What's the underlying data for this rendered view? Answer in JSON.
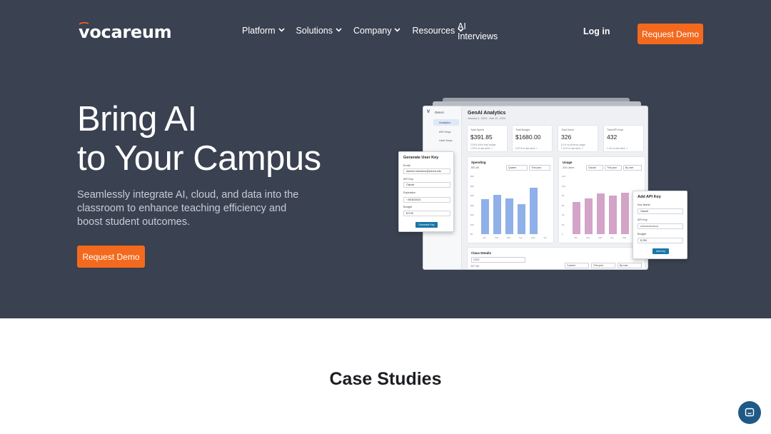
{
  "brand": {
    "logo_text": "vocareum",
    "accent_color": "#f36a1e",
    "hero_bg": "#3a4150"
  },
  "nav": {
    "items": [
      {
        "label": "Platform"
      },
      {
        "label": "Solutions"
      },
      {
        "label": "Company"
      },
      {
        "label": "Resources"
      }
    ],
    "ai_interviews": {
      "line1": "AI",
      "line2": "Interviews"
    },
    "login": "Log in",
    "request_demo": "Request Demo"
  },
  "hero": {
    "headline_line1": "Bring AI",
    "headline_line2": "to Your Campus",
    "subtext": "Seamlessly integrate AI, cloud, and data into the classroom to enhance teaching efficiency and boost student outcomes.",
    "cta": "Request Demo"
  },
  "mockup": {
    "sidebar": {
      "logo": "V",
      "title": "GenAI",
      "items": [
        "Analytics",
        "API Keys",
        "User Keys"
      ]
    },
    "title": "GenAI Analytics",
    "date_range": "January 1, 2024 - Mar 20, 2024",
    "stats": [
      {
        "label": "Total Spend",
        "value": "$391.85",
        "sub1": "23.8% of the total budget",
        "sub2": "1.29% vs last week ↗"
      },
      {
        "label": "Total Budget",
        "value": "$1680.00",
        "sub1": "",
        "sub2": "0.87% vs last week ↗"
      },
      {
        "label": "Total Users",
        "value": "326",
        "sub1": "8.1% vs previous usage",
        "sub2": "1.12% vs last week ↗"
      },
      {
        "label": "Total API Keys",
        "value": "432",
        "sub1": "",
        "sub2": "1.1% vs last week ↗"
      }
    ],
    "spending": {
      "title": "Spending",
      "total": "$91.85",
      "filters": [
        "Quarter",
        "This year"
      ],
      "yticks": [
        "$60",
        "$50",
        "$40",
        "$30",
        "$20",
        "$10",
        "$0"
      ],
      "months": [
        "Jan",
        "Feb",
        "Mar",
        "Apr",
        "May",
        "Jun"
      ],
      "values": [
        0.6,
        0.68,
        0.62,
        0.52,
        0.8,
        0.0
      ],
      "color": "#8fb0e8"
    },
    "usage": {
      "title": "Usage",
      "total": "234 Users",
      "filters": [
        "Claude",
        "This year",
        "By user"
      ],
      "yticks": [
        "120",
        "100",
        "80",
        "60",
        "40",
        "20",
        "0"
      ],
      "months": [
        "Jan",
        "Feb",
        "Mar",
        "Apr",
        "Mar",
        "Jun"
      ],
      "values": [
        0.55,
        0.62,
        0.7,
        0.67,
        0.72,
        0.66
      ],
      "color": "#d3a3c8"
    },
    "class_details": {
      "title": "Class Details",
      "select": "CS47",
      "amount": "$77.56",
      "filters": [
        "Content",
        "This year",
        "By cost"
      ]
    },
    "user_key_card": {
      "title": "Generate User Key",
      "email_label": "Email",
      "email_value": "darlene.robertson@school.edu",
      "api_key_label": "API Key",
      "api_key_value": "Claude",
      "expiration_label": "Expiration",
      "expiration_value": "05/30/2024",
      "budget_label": "Budget",
      "budget_currency": "$",
      "budget_value": "5.00",
      "button": "Generate Key"
    },
    "api_key_card": {
      "title": "Add API Key",
      "name_label": "Key Name",
      "name_value": "Claude",
      "api_label": "API Key",
      "api_value": "••••••••••••••••••••",
      "budget_label": "Budget",
      "budget_currency": "$",
      "budget_value": "250",
      "button": "Add key"
    }
  },
  "case_studies": {
    "title": "Case Studies"
  },
  "chat": {
    "icon": "chat-bubble-icon"
  }
}
